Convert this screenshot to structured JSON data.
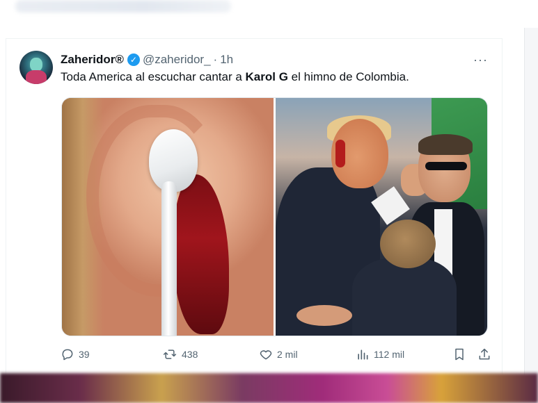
{
  "tweet": {
    "author_name": "Zaheridor®",
    "verified_mark": "✓",
    "handle": "@zaheridor_",
    "separator": "·",
    "time": "1h",
    "more": "···",
    "text_before": "Toda America al escuchar cantar a ",
    "text_bold": "Karol G",
    "text_after": " el himno de Colombia."
  },
  "actions": {
    "replies": "39",
    "retweets": "438",
    "likes": "2 mil",
    "views": "112 mil"
  },
  "icons": {
    "reply": "reply-icon",
    "retweet": "retweet-icon",
    "like": "heart-icon",
    "views": "analytics-icon",
    "bookmark": "bookmark-icon",
    "share": "share-icon"
  },
  "colors": {
    "verified": "#1d9bf0",
    "muted_text": "#536471",
    "text": "#0f1419"
  }
}
